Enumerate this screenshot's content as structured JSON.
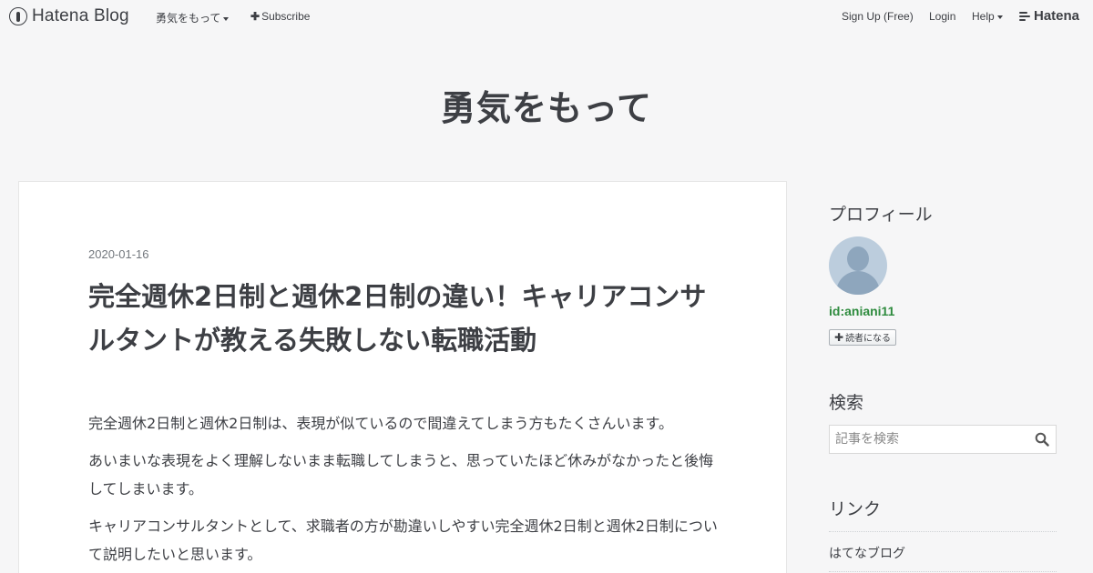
{
  "topbar": {
    "logo_text": "Hatena Blog",
    "blog_menu": "勇気をもって",
    "subscribe": "Subscribe",
    "signup": "Sign Up (Free)",
    "login": "Login",
    "help": "Help",
    "brand": "Hatena"
  },
  "blog": {
    "title": "勇気をもって"
  },
  "entry": {
    "date": "2020-01-16",
    "title": "完全週休2日制と週休2日制の違い！キャリアコンサルタントが教える失敗しない転職活動",
    "paragraphs": [
      "完全週休2日制と週休2日制は、表現が似ているので間違えてしまう方もたくさんいます。",
      "あいまいな表現をよく理解しないまま転職してしまうと、思っていたほど休みがなかったと後悔してしまいます。",
      "キャリアコンサルタントとして、求職者の方が勘違いしやすい完全週休2日制と週休2日制について説明したいと思います。"
    ]
  },
  "sidebar": {
    "profile_heading": "プロフィール",
    "user_id": "id:aniani11",
    "follow_label": "読者になる",
    "search_heading": "検索",
    "search_placeholder": "記事を検索",
    "links_heading": "リンク",
    "links": [
      "はてなブログ"
    ]
  },
  "colors": {
    "background": "#f6f6f7",
    "text": "#3d3f44",
    "user_id": "#2e8b3e"
  }
}
